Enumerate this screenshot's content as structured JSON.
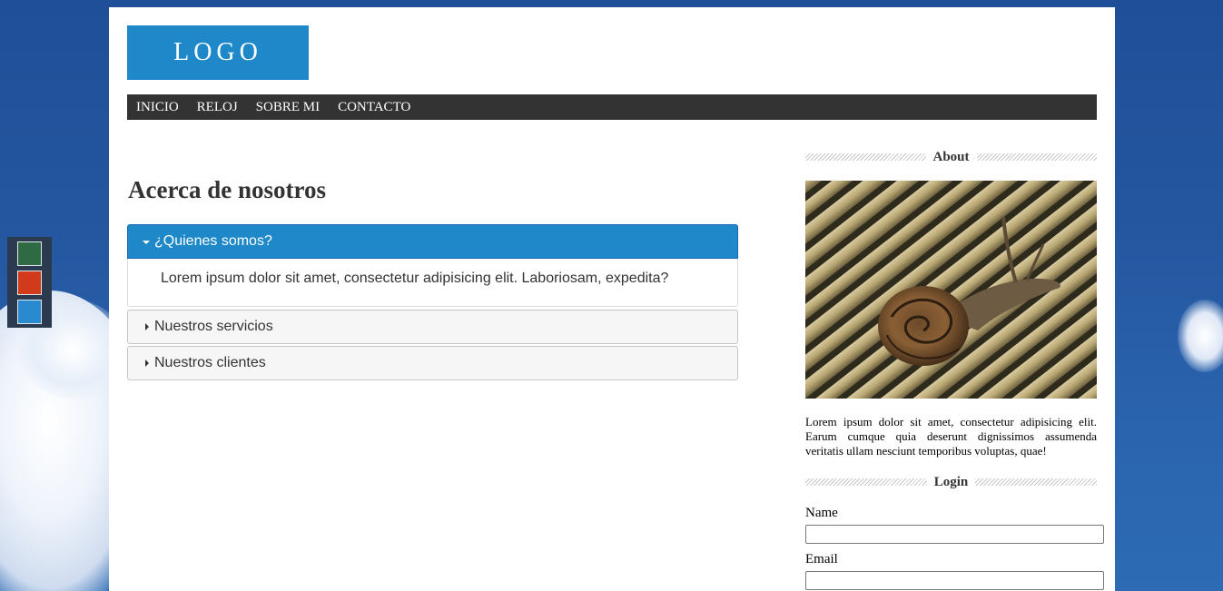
{
  "theme": {
    "accent": "#1e88c8",
    "nav_bg": "#333333",
    "swatches": [
      "#2e6b44",
      "#d23a1c",
      "#2a8ad0"
    ]
  },
  "header": {
    "logo_text": "LOGO",
    "nav": [
      "INICIO",
      "RELOJ",
      "SOBRE MI",
      "CONTACTO"
    ]
  },
  "main": {
    "title": "Acerca de nosotros",
    "accordion": [
      {
        "title": "¿Quienes somos?",
        "expanded": true,
        "body": "Lorem ipsum dolor sit amet, consectetur adipisicing elit. Laboriosam, expedita?"
      },
      {
        "title": "Nuestros servicios",
        "expanded": false
      },
      {
        "title": "Nuestros clientes",
        "expanded": false
      }
    ]
  },
  "sidebar": {
    "about_title": "About",
    "about_text": "Lorem ipsum dolor sit amet, consectetur adipisicing elit. Earum cumque quia deserunt dignissimos assumenda veritatis ullam nesciunt temporibus voluptas, quae!",
    "login_title": "Login",
    "name_label": "Name",
    "email_label": "Email",
    "name_value": "",
    "email_value": ""
  }
}
